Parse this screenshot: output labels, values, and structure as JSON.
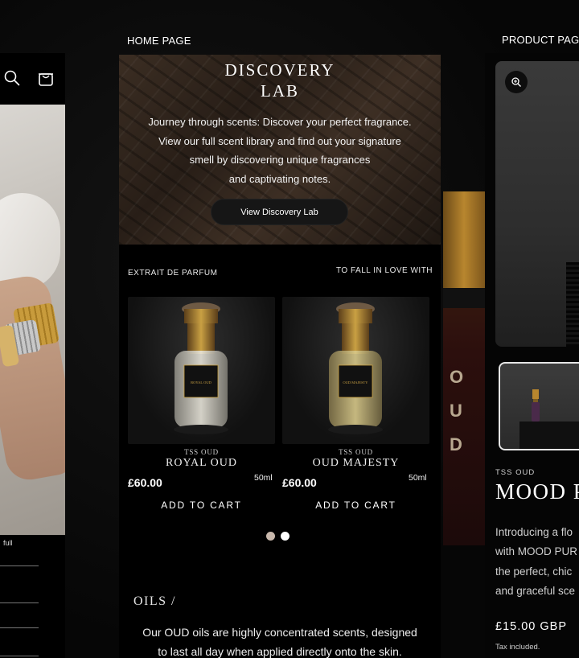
{
  "labels": {
    "home_page": "HOME PAGE",
    "product_page": "PRODUCT PAGE"
  },
  "left_screen": {
    "icons": [
      "search-icon",
      "shopping-bag-icon"
    ],
    "snippet_text": "full"
  },
  "hero": {
    "title": "DISCOVERY\nLAB",
    "description": "Journey through scents: Discover your perfect fragrance.\nView our full scent library and find out  your signature\nsmell by discovering unique fragrances\nand captivating notes.",
    "button_label": "View Discovery Lab"
  },
  "collection": {
    "left_label": "EXTRAIT DE PARFUM",
    "right_label": "TO FALL IN LOVE WITH",
    "products": [
      {
        "brand": "TSS OUD",
        "name": "ROYAL OUD",
        "price": "£60.00",
        "size": "50ml",
        "cta": "ADD TO CART",
        "bottle_label": "ROYAL OUD",
        "liquid_color": "#d8d4c6"
      },
      {
        "brand": "TSS OUD",
        "name": "OUD MAJESTY",
        "price": "£60.00",
        "size": "50ml",
        "cta": "ADD TO CART",
        "bottle_label": "OUD MAJESTY",
        "liquid_color": "#c9ba7c"
      }
    ],
    "carousel_dots": 2,
    "active_dot": 1
  },
  "oils": {
    "title": "OILS /",
    "description": "Our OUD oils are highly concentrated scents, designed\nto last all day when applied directly onto the skin."
  },
  "product_page": {
    "brand": "TSS OUD",
    "title": "MOOD PURE",
    "description": "Introducing a flo\nwith MOOD PUR\nthe perfect, chic\nand graceful sce",
    "price": "£15.00 GBP",
    "tax_note": "Tax included."
  },
  "colors": {
    "background": "#060606",
    "gold": "#c9a043",
    "dot_inactive": "#c8b8ac",
    "dot_active": "#ffffff"
  }
}
